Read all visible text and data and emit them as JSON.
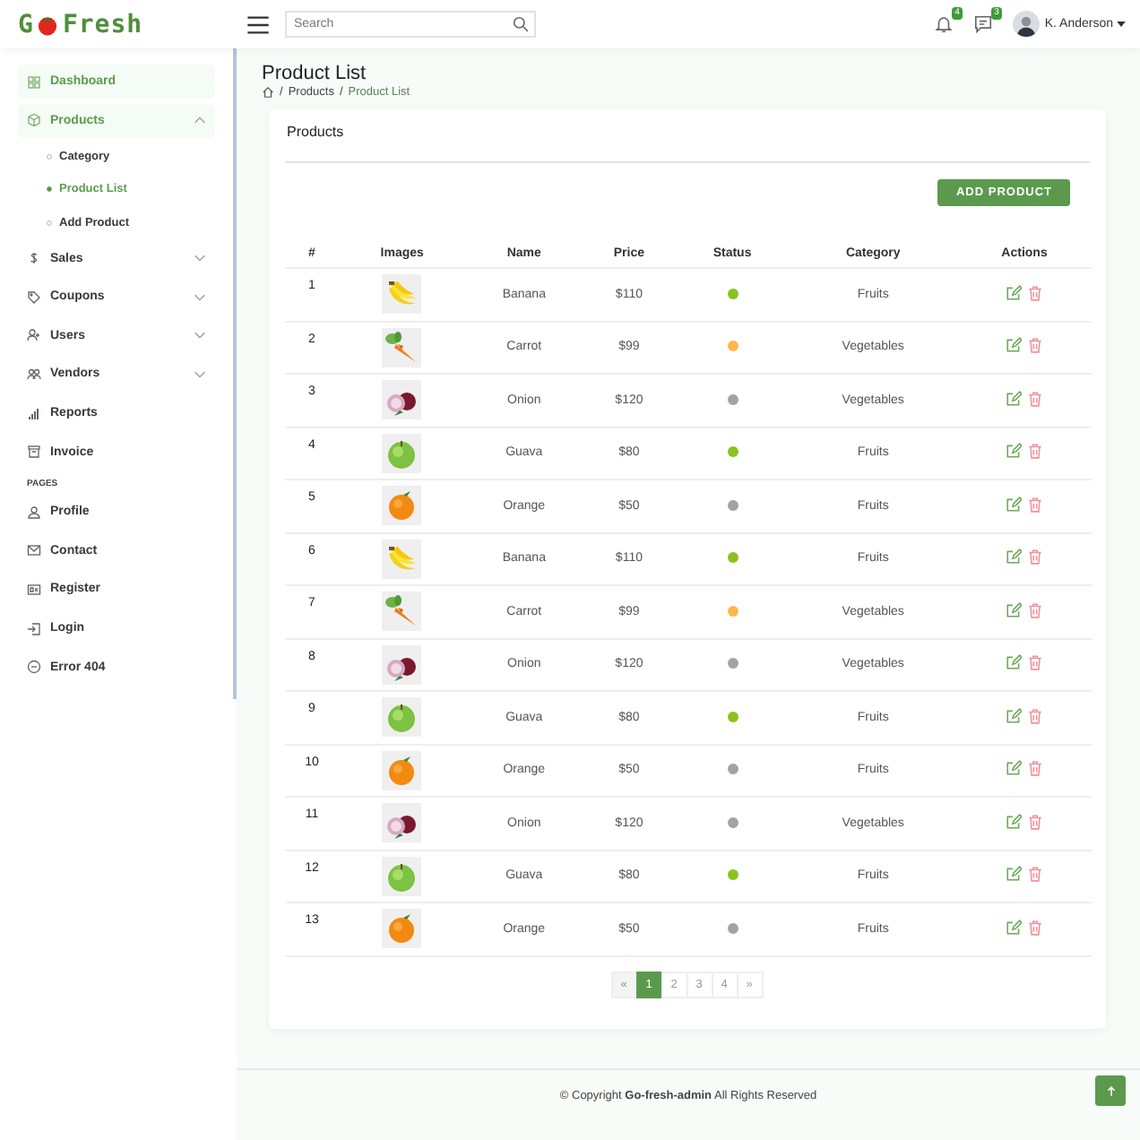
{
  "header": {
    "logo": {
      "before": "G",
      "after": "Fresh"
    },
    "search": {
      "placeholder": "Search"
    },
    "notifications": {
      "count": "4"
    },
    "messages": {
      "count": "3"
    },
    "user": {
      "name": "K. Anderson"
    }
  },
  "sidebar": {
    "items": [
      {
        "kind": "link",
        "label": "Dashboard",
        "selected": true
      },
      {
        "kind": "group",
        "label": "Products",
        "selected": true,
        "expanded": true,
        "children": [
          {
            "label": "Category",
            "selected": false
          },
          {
            "label": "Product List",
            "selected": true
          },
          {
            "label": "Add Product",
            "selected": false
          }
        ]
      },
      {
        "kind": "group",
        "label": "Sales",
        "selected": false,
        "expanded": false
      },
      {
        "kind": "group",
        "label": "Coupons",
        "selected": false,
        "expanded": false
      },
      {
        "kind": "group",
        "label": "Users",
        "selected": false,
        "expanded": false
      },
      {
        "kind": "group",
        "label": "Vendors",
        "selected": false,
        "expanded": false
      },
      {
        "kind": "link",
        "label": "Reports",
        "selected": false
      },
      {
        "kind": "link",
        "label": "Invoice",
        "selected": false
      },
      {
        "kind": "heading",
        "label": "PAGES"
      },
      {
        "kind": "link",
        "label": "Profile",
        "selected": false
      },
      {
        "kind": "link",
        "label": "Contact",
        "selected": false
      },
      {
        "kind": "link",
        "label": "Register",
        "selected": false
      },
      {
        "kind": "link",
        "label": "Login",
        "selected": false
      },
      {
        "kind": "link",
        "label": "Error 404",
        "selected": false
      }
    ]
  },
  "page": {
    "title": "Product List",
    "breadcrumb_separator": "/",
    "breadcrumb": [
      "Products",
      "Product List"
    ]
  },
  "card": {
    "title": "Products",
    "add_button": "ADD PRODUCT"
  },
  "table": {
    "columns": [
      "#",
      "Images",
      "Name",
      "Price",
      "Status",
      "Category",
      "Actions"
    ],
    "rows": [
      {
        "no": "1",
        "name": "Banana",
        "price": "$110",
        "color": "#8cc21e",
        "category": "Fruits"
      },
      {
        "no": "2",
        "name": "Carrot",
        "price": "$99",
        "color": "#ffb648",
        "category": "Vegetables"
      },
      {
        "no": "3",
        "name": "Onion",
        "price": "$120",
        "color": "#a3a3a3",
        "category": "Vegetables"
      },
      {
        "no": "4",
        "name": "Guava",
        "price": "$80",
        "color": "#8cc21e",
        "category": "Fruits"
      },
      {
        "no": "5",
        "name": "Orange",
        "price": "$50",
        "color": "#a3a3a3",
        "category": "Fruits"
      },
      {
        "no": "6",
        "name": "Banana",
        "price": "$110",
        "color": "#8cc21e",
        "category": "Fruits"
      },
      {
        "no": "7",
        "name": "Carrot",
        "price": "$99",
        "color": "#ffb648",
        "category": "Vegetables"
      },
      {
        "no": "8",
        "name": "Onion",
        "price": "$120",
        "color": "#a3a3a3",
        "category": "Vegetables"
      },
      {
        "no": "9",
        "name": "Guava",
        "price": "$80",
        "color": "#8cc21e",
        "category": "Fruits"
      },
      {
        "no": "10",
        "name": "Orange",
        "price": "$50",
        "color": "#a3a3a3",
        "category": "Fruits"
      },
      {
        "no": "11",
        "name": "Onion",
        "price": "$120",
        "color": "#a3a3a3",
        "category": "Vegetables"
      },
      {
        "no": "12",
        "name": "Guava",
        "price": "$80",
        "color": "#8cc21e",
        "category": "Fruits"
      },
      {
        "no": "13",
        "name": "Orange",
        "price": "$50",
        "color": "#a3a3a3",
        "category": "Fruits"
      }
    ]
  },
  "pagination": [
    {
      "label": "«",
      "selected": false,
      "disabled": true
    },
    {
      "label": "1",
      "selected": true,
      "disabled": false
    },
    {
      "label": "2",
      "selected": false,
      "disabled": false
    },
    {
      "label": "3",
      "selected": false,
      "disabled": false
    },
    {
      "label": "4",
      "selected": false,
      "disabled": false
    },
    {
      "label": "»",
      "selected": false,
      "disabled": false
    }
  ],
  "footer": {
    "copyright": "© Copyright **Go-fresh-admin** All Rights Reserved"
  }
}
